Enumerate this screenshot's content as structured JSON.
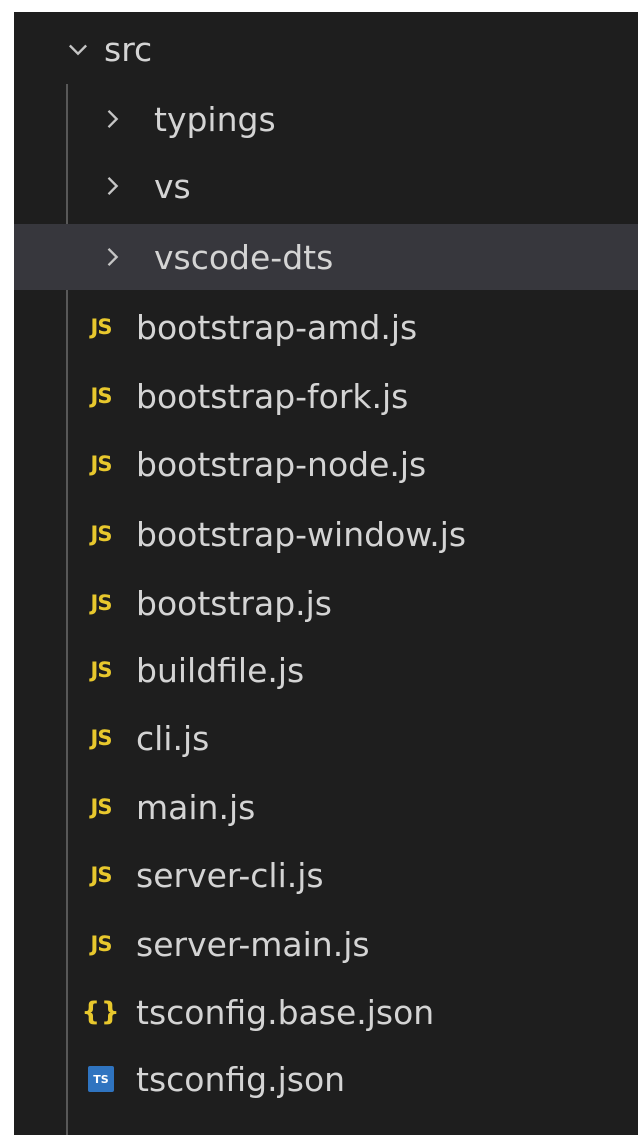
{
  "explorer": {
    "root": {
      "label": "src",
      "expanded": true,
      "icon": "chevron-down-icon"
    },
    "folders": [
      {
        "label": "typings",
        "icon": "chevron-right-icon",
        "selected": false
      },
      {
        "label": "vs",
        "icon": "chevron-right-icon",
        "selected": false
      },
      {
        "label": "vscode-dts",
        "icon": "chevron-right-icon",
        "selected": true
      }
    ],
    "files": [
      {
        "label": "bootstrap-amd.js",
        "icon": "js-file-icon",
        "icon_text": "JS"
      },
      {
        "label": "bootstrap-fork.js",
        "icon": "js-file-icon",
        "icon_text": "JS"
      },
      {
        "label": "bootstrap-node.js",
        "icon": "js-file-icon",
        "icon_text": "JS"
      },
      {
        "label": "bootstrap-window.js",
        "icon": "js-file-icon",
        "icon_text": "JS"
      },
      {
        "label": "bootstrap.js",
        "icon": "js-file-icon",
        "icon_text": "JS"
      },
      {
        "label": "buildfile.js",
        "icon": "js-file-icon",
        "icon_text": "JS"
      },
      {
        "label": "cli.js",
        "icon": "js-file-icon",
        "icon_text": "JS"
      },
      {
        "label": "main.js",
        "icon": "js-file-icon",
        "icon_text": "JS"
      },
      {
        "label": "server-cli.js",
        "icon": "js-file-icon",
        "icon_text": "JS"
      },
      {
        "label": "server-main.js",
        "icon": "js-file-icon",
        "icon_text": "JS"
      },
      {
        "label": "tsconfig.base.json",
        "icon": "json-file-icon",
        "icon_text": "{}"
      },
      {
        "label": "tsconfig.json",
        "icon": "ts-file-icon",
        "icon_text": "TS"
      }
    ]
  },
  "colors": {
    "panel_background": "#1e1e1e",
    "selected_row": "#37373d",
    "text": "#d4d4d4",
    "js_icon": "#e8c82d",
    "ts_icon": "#2f74c0",
    "indent_guide": "#585858"
  }
}
